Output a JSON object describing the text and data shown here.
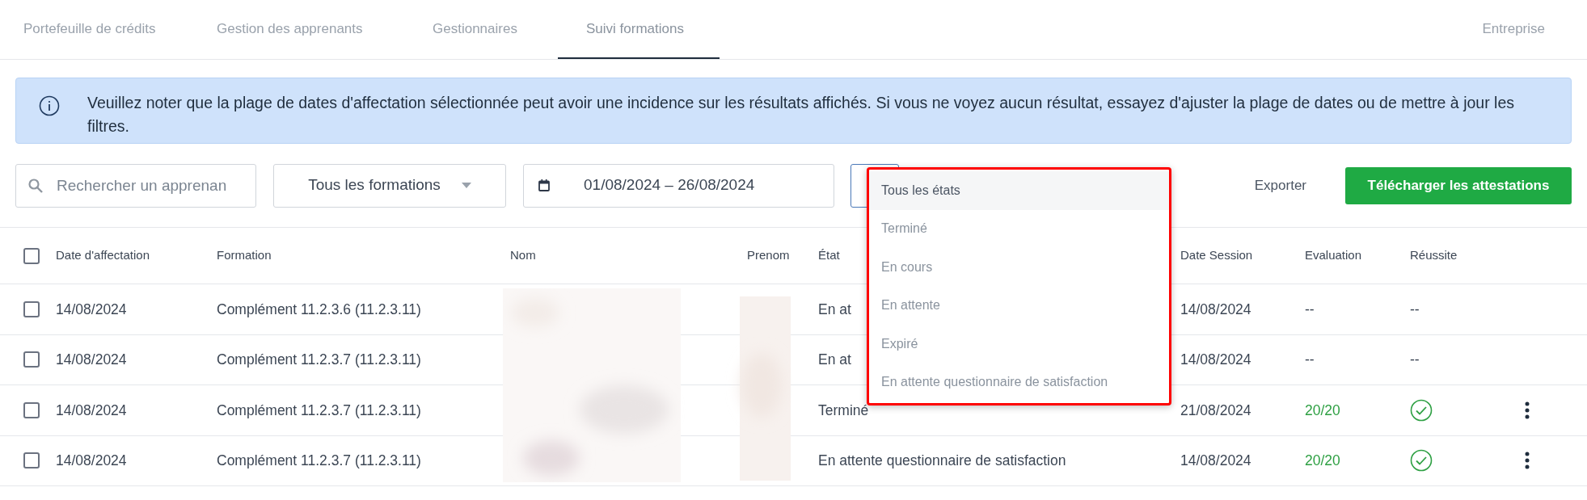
{
  "tabs": [
    {
      "label": "Portefeuille de crédits",
      "selected": false
    },
    {
      "label": "Gestion des apprenants",
      "selected": false
    },
    {
      "label": "Gestionnaires",
      "selected": false
    },
    {
      "label": "Suivi formations",
      "selected": true
    }
  ],
  "company_tab": {
    "label": "Entreprise",
    "selected": false
  },
  "notice": "Veuillez noter que la plage de dates d'affectation sélectionnée peut avoir une incidence sur les résultats affichés. Si vous ne voyez aucun résultat, essayez d'ajuster la plage de dates ou de mettre à jour les filtres.",
  "filters": {
    "search": {
      "placeholder": "Rechercher un apprenan"
    },
    "formation_select": "Tous les formations",
    "date_range": "01/08/2024 – 26/08/2024",
    "state_select": {
      "focused": true
    }
  },
  "export_link": "Exporter",
  "download_button": "Télécharger les attestations",
  "state_dropdown": {
    "highlighted": true,
    "options": [
      {
        "label": "Tous les états",
        "selected": true
      },
      {
        "label": "Terminé",
        "selected": false
      },
      {
        "label": "En cours",
        "selected": false
      },
      {
        "label": "En attente",
        "selected": false
      },
      {
        "label": "Expiré",
        "selected": false
      },
      {
        "label": "En attente questionnaire de satisfaction",
        "selected": false
      }
    ]
  },
  "table": {
    "select_all": {
      "checked": false
    },
    "columns": [
      "Date d'affectation",
      "Formation",
      "Nom",
      "Prenom",
      "État",
      "Date Session",
      "Evaluation",
      "Réussite"
    ],
    "rows": [
      {
        "checked": false,
        "date": "14/08/2024",
        "formation": "Complément 11.2.3.6 (11.2.3.11)",
        "etat": "En at",
        "date_session": "14/08/2024",
        "evaluation": "--",
        "passed": false,
        "reussite": "--",
        "menu": false
      },
      {
        "checked": false,
        "date": "14/08/2024",
        "formation": "Complément 11.2.3.7 (11.2.3.11)",
        "etat": "En at",
        "date_session": "14/08/2024",
        "evaluation": "--",
        "passed": false,
        "reussite": "--",
        "menu": false
      },
      {
        "checked": false,
        "date": "14/08/2024",
        "formation": "Complément 11.2.3.7 (11.2.3.11)",
        "etat": "Terminé",
        "date_session": "21/08/2024",
        "evaluation": "20/20",
        "passed": true,
        "menu": true
      },
      {
        "checked": false,
        "date": "14/08/2024",
        "formation": "Complément 11.2.3.7 (11.2.3.11)",
        "etat": "En attente questionnaire de satisfaction",
        "date_session": "14/08/2024",
        "evaluation": "20/20",
        "passed": true,
        "menu": true
      }
    ]
  }
}
